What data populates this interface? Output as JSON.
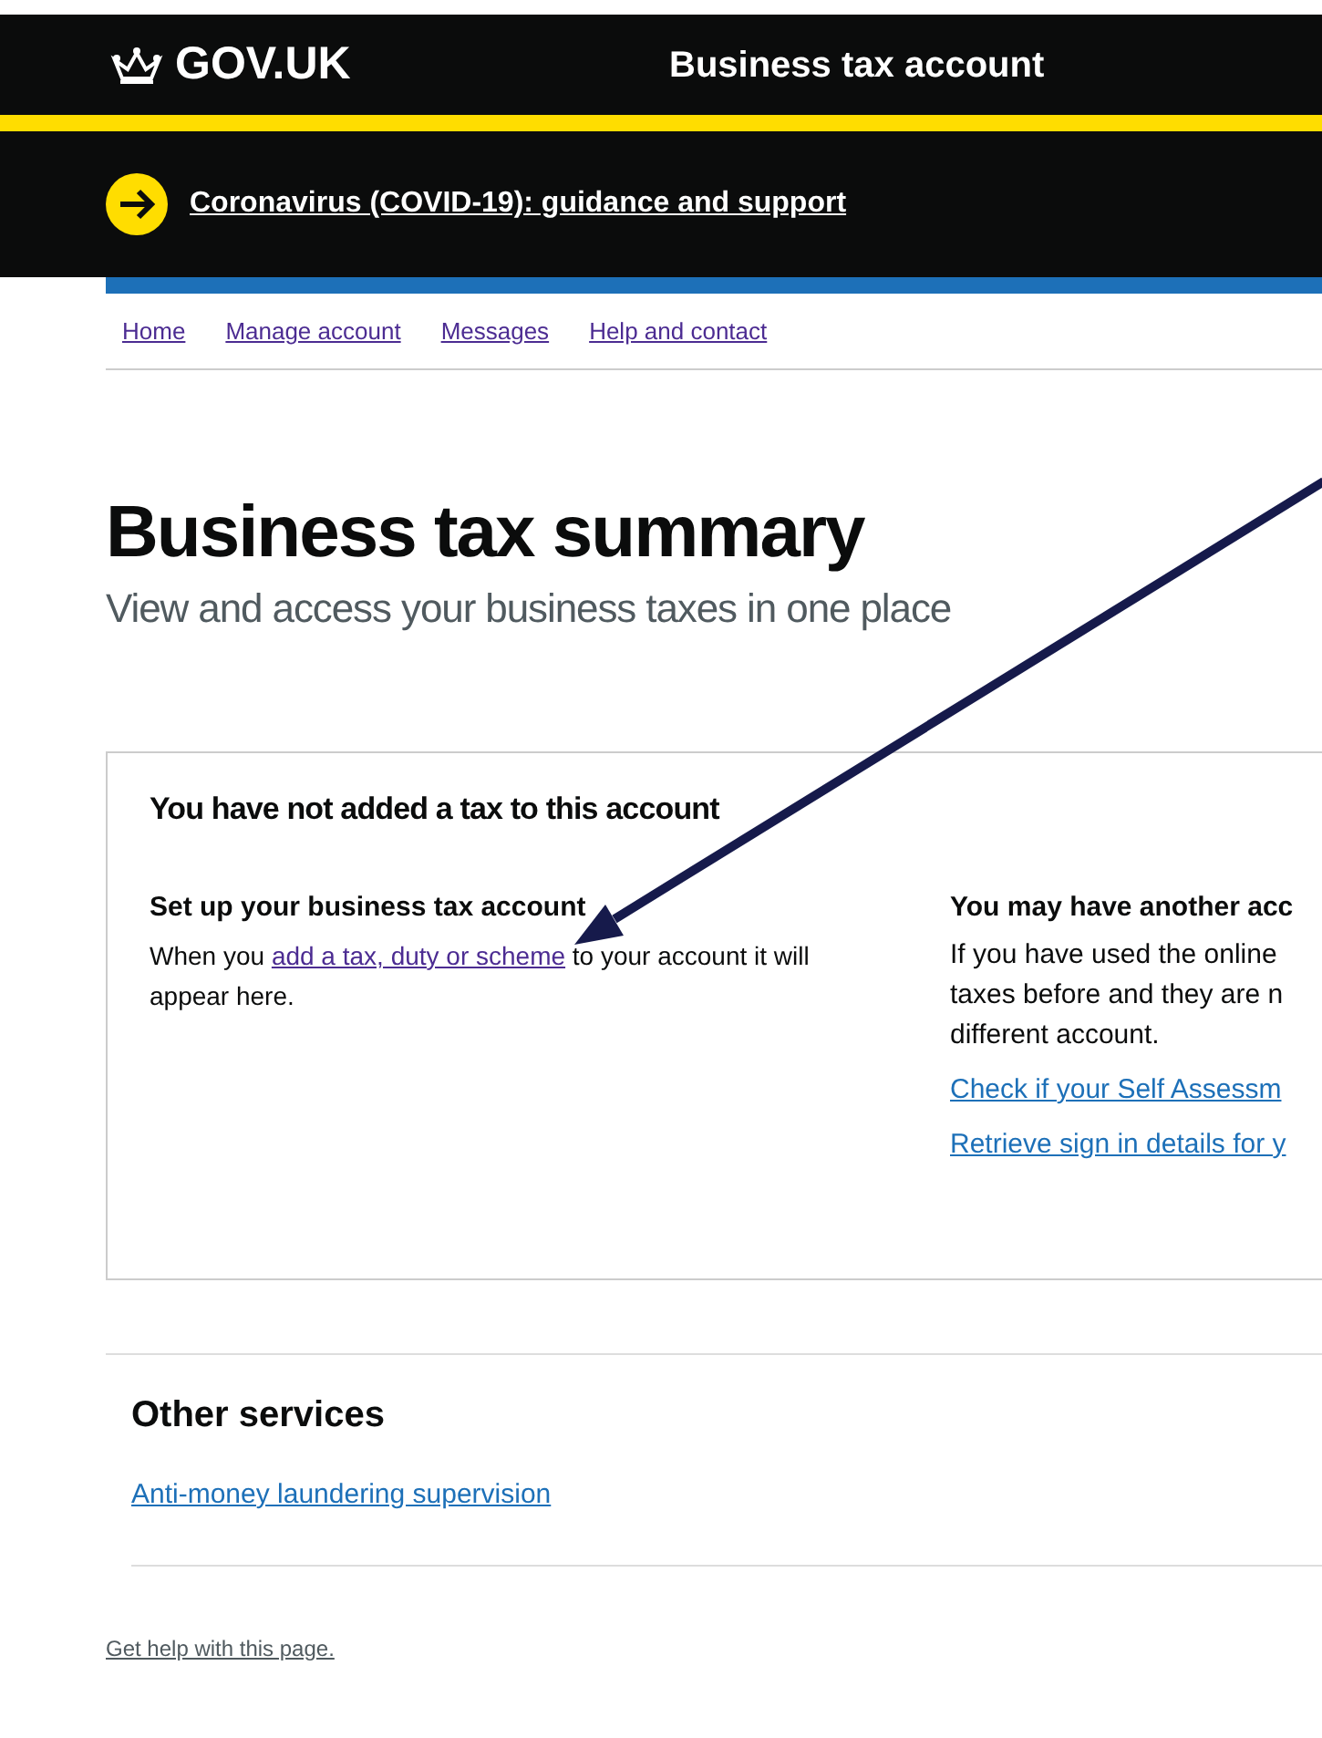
{
  "header": {
    "logo": "GOV.UK",
    "service": "Business tax account"
  },
  "banner": {
    "link": "Coronavirus (COVID-19): guidance and support"
  },
  "nav": [
    {
      "label": "Home",
      "visited": true
    },
    {
      "label": "Manage account",
      "visited": true
    },
    {
      "label": "Messages",
      "visited": true
    },
    {
      "label": "Help and contact",
      "visited": true
    }
  ],
  "page": {
    "title": "Business tax summary",
    "subtitle": "View and access your business taxes in one place"
  },
  "panel": {
    "heading": "You have not added a tax to this account",
    "left": {
      "heading": "Set up your business tax account",
      "text_before": "When you",
      "link": "add a tax, duty or scheme",
      "text_after": "to your account it will appear here."
    },
    "right": {
      "heading": "You may have another acc",
      "lines": [
        "If you have used the online",
        "taxes before and they are n",
        "different account."
      ],
      "links": [
        "Check if your Self Assessm",
        "Retrieve sign in details for y"
      ]
    }
  },
  "other_services": {
    "heading": "Other services",
    "links": [
      "Anti-money laundering supervision"
    ]
  },
  "footer": {
    "link": "Get help with this page."
  }
}
